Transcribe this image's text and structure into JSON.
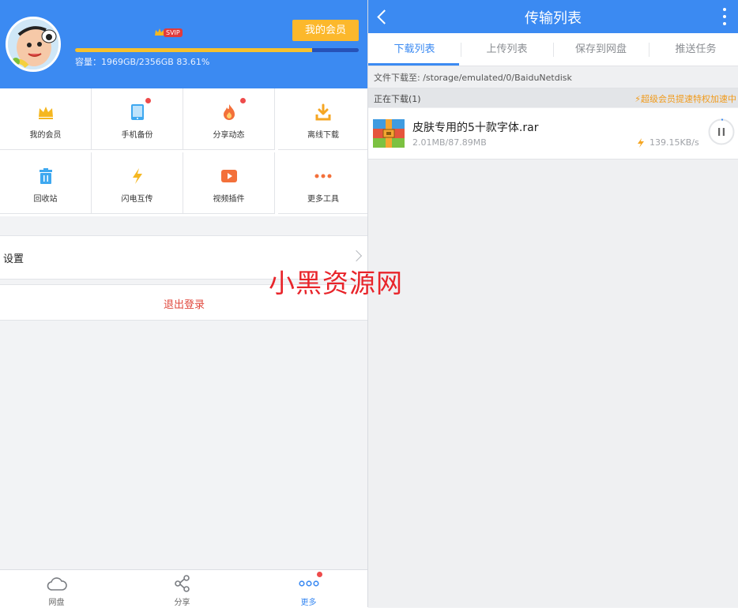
{
  "left": {
    "profile": {
      "svip_badge": "SVIP",
      "member_button": "我的会员",
      "capacity_text": "容量：1969GB/2356GB 83.61%",
      "capacity_fraction": 0.8361
    },
    "grid": [
      {
        "label": "我的会员",
        "icon": "crown-icon",
        "badge": false
      },
      {
        "label": "手机备份",
        "icon": "phone-icon",
        "badge": true
      },
      {
        "label": "分享动态",
        "icon": "flame-icon",
        "badge": true
      },
      {
        "label": "离线下载",
        "icon": "download-icon",
        "badge": false
      },
      {
        "label": "回收站",
        "icon": "trash-icon",
        "badge": false
      },
      {
        "label": "闪电互传",
        "icon": "lightning-icon",
        "badge": false
      },
      {
        "label": "视频插件",
        "icon": "video-play-icon",
        "badge": false
      },
      {
        "label": "更多工具",
        "icon": "more-dots-icon",
        "badge": false
      }
    ],
    "settings_label": "设置",
    "logout_label": "退出登录",
    "watermark": "小黑资源网",
    "bottom_nav": [
      {
        "label": "网盘",
        "icon": "cloud-icon"
      },
      {
        "label": "分享",
        "icon": "share-icon"
      },
      {
        "label": "更多",
        "icon": "more-icon"
      }
    ]
  },
  "right": {
    "title": "传输列表",
    "tabs": [
      "下载列表",
      "上传列表",
      "保存到网盘",
      "推送任务"
    ],
    "download_path": "文件下载至: /storage/emulated/0/BaiduNetdisk",
    "section": {
      "label": "正在下载(1)",
      "promo": "⚡超级会员提速特权加速中"
    },
    "task": {
      "name": "皮肤专用的5十款字体.rar",
      "size": "2.01MB/87.89MB",
      "speed": "139.15KB/s"
    }
  },
  "colors": {
    "primary": "#3b8af2",
    "member_gold": "#fcb82c",
    "danger": "#e0473c",
    "promo": "#f19a1a"
  }
}
